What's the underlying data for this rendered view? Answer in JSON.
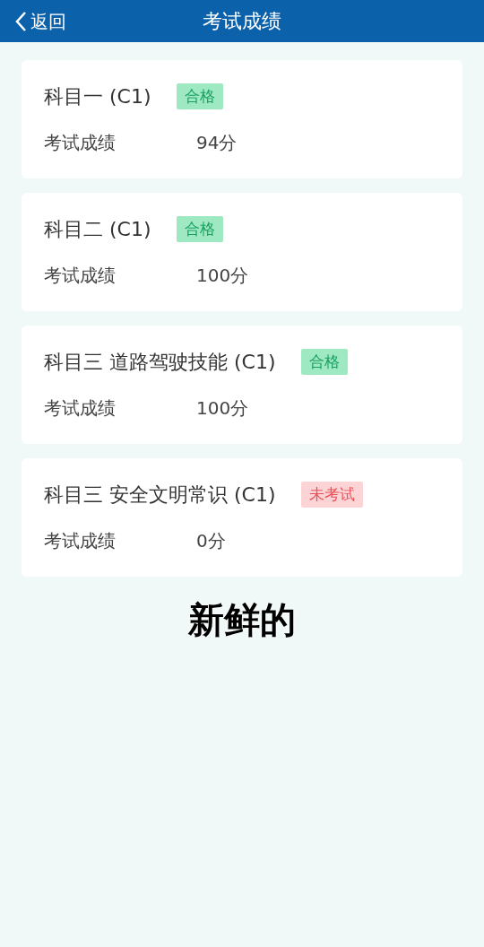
{
  "header": {
    "back": "返回",
    "title": "考试成绩"
  },
  "subjects": [
    {
      "name": "科目一 (C1)",
      "badge": {
        "text": "合格",
        "kind": "pass"
      },
      "label": "考试成绩",
      "score": "94分"
    },
    {
      "name": "科目二 (C1)",
      "badge": {
        "text": "合格",
        "kind": "pass"
      },
      "label": "考试成绩",
      "score": "100分"
    },
    {
      "name": "科目三 道路驾驶技能 (C1)",
      "badge": {
        "text": "合格",
        "kind": "pass"
      },
      "label": "考试成绩",
      "score": "100分"
    },
    {
      "name": "科目三 安全文明常识 (C1)",
      "badge": {
        "text": "未考试",
        "kind": "untested"
      },
      "label": "考试成绩",
      "score": "0分"
    }
  ],
  "caption": "新鲜的"
}
